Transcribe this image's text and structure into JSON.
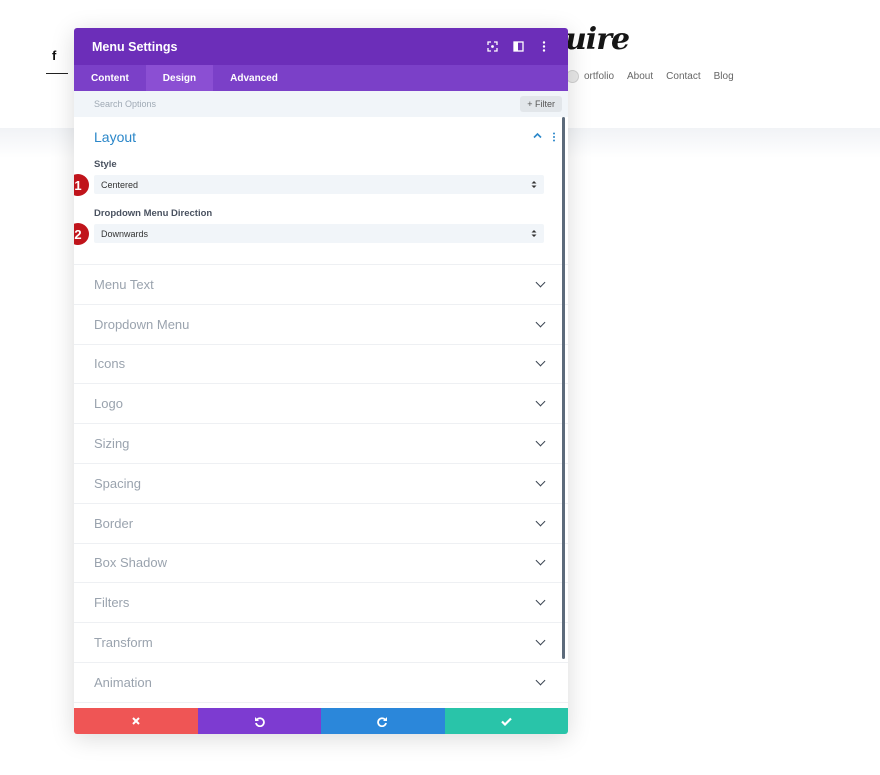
{
  "background": {
    "logo": "uire",
    "nav": [
      "ortfolio",
      "About",
      "Contact",
      "Blog"
    ],
    "social_icon": "f"
  },
  "modal": {
    "title": "Menu Settings",
    "tabs": [
      "Content",
      "Design",
      "Advanced"
    ],
    "active_tab": "Design",
    "search_placeholder": "Search Options",
    "filter_label": "+ Filter",
    "layout": {
      "title": "Layout",
      "style_label": "Style",
      "style_value": "Centered",
      "direction_label": "Dropdown Menu Direction",
      "direction_value": "Downwards",
      "badge1": "1",
      "badge2": "2"
    },
    "sections": [
      "Menu Text",
      "Dropdown Menu",
      "Icons",
      "Logo",
      "Sizing",
      "Spacing",
      "Border",
      "Box Shadow",
      "Filters",
      "Transform",
      "Animation"
    ]
  },
  "colors": {
    "header": "#6c2eb9",
    "tabs": "#7b40c8",
    "accent": "#2b87c9",
    "cancel": "#ef5555",
    "undo": "#7d3bd1",
    "redo": "#2b87da",
    "save": "#29c4a9",
    "badge": "#c0141b"
  }
}
